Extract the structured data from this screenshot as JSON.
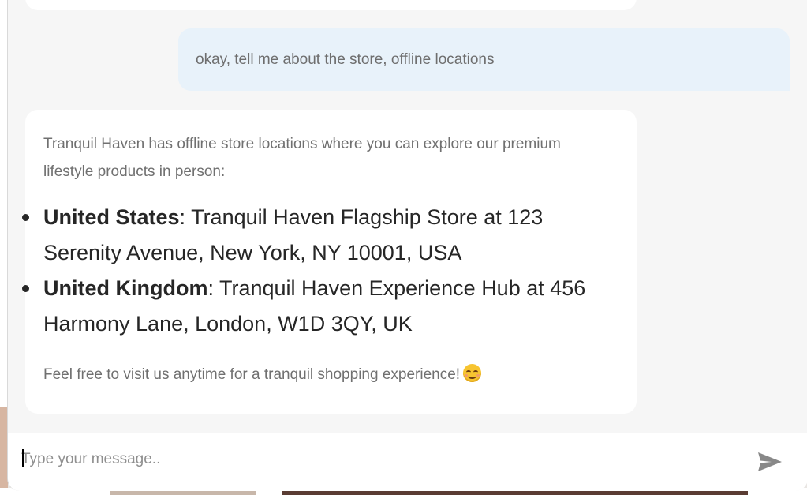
{
  "chat": {
    "user_message": "okay, tell me about the store, offline locations",
    "bot_intro": "Tranquil Haven has offline store locations where you can explore our premium lifestyle products in person:",
    "locations": [
      {
        "country": "United States",
        "separator": ":",
        "details": " Tranquil Haven Flagship Store at 123 Serenity Avenue, New York, NY 10001, USA"
      },
      {
        "country": "United Kingdom",
        "separator": ":",
        "details": " Tranquil Haven Experience Hub at 456 Harmony Lane, London, W1D 3QY, UK"
      }
    ],
    "bot_outro": "Feel free to visit us anytime for a tranquil shopping experience!",
    "emoji_icon": "smiling-face-icon"
  },
  "composer": {
    "placeholder": "Type your message..",
    "send_icon": "send-icon"
  },
  "colors": {
    "user_bubble": "#e8f2fa",
    "bot_bubble": "#ffffff",
    "chat_background": "#f6f6f6",
    "send_icon": "#888888"
  }
}
